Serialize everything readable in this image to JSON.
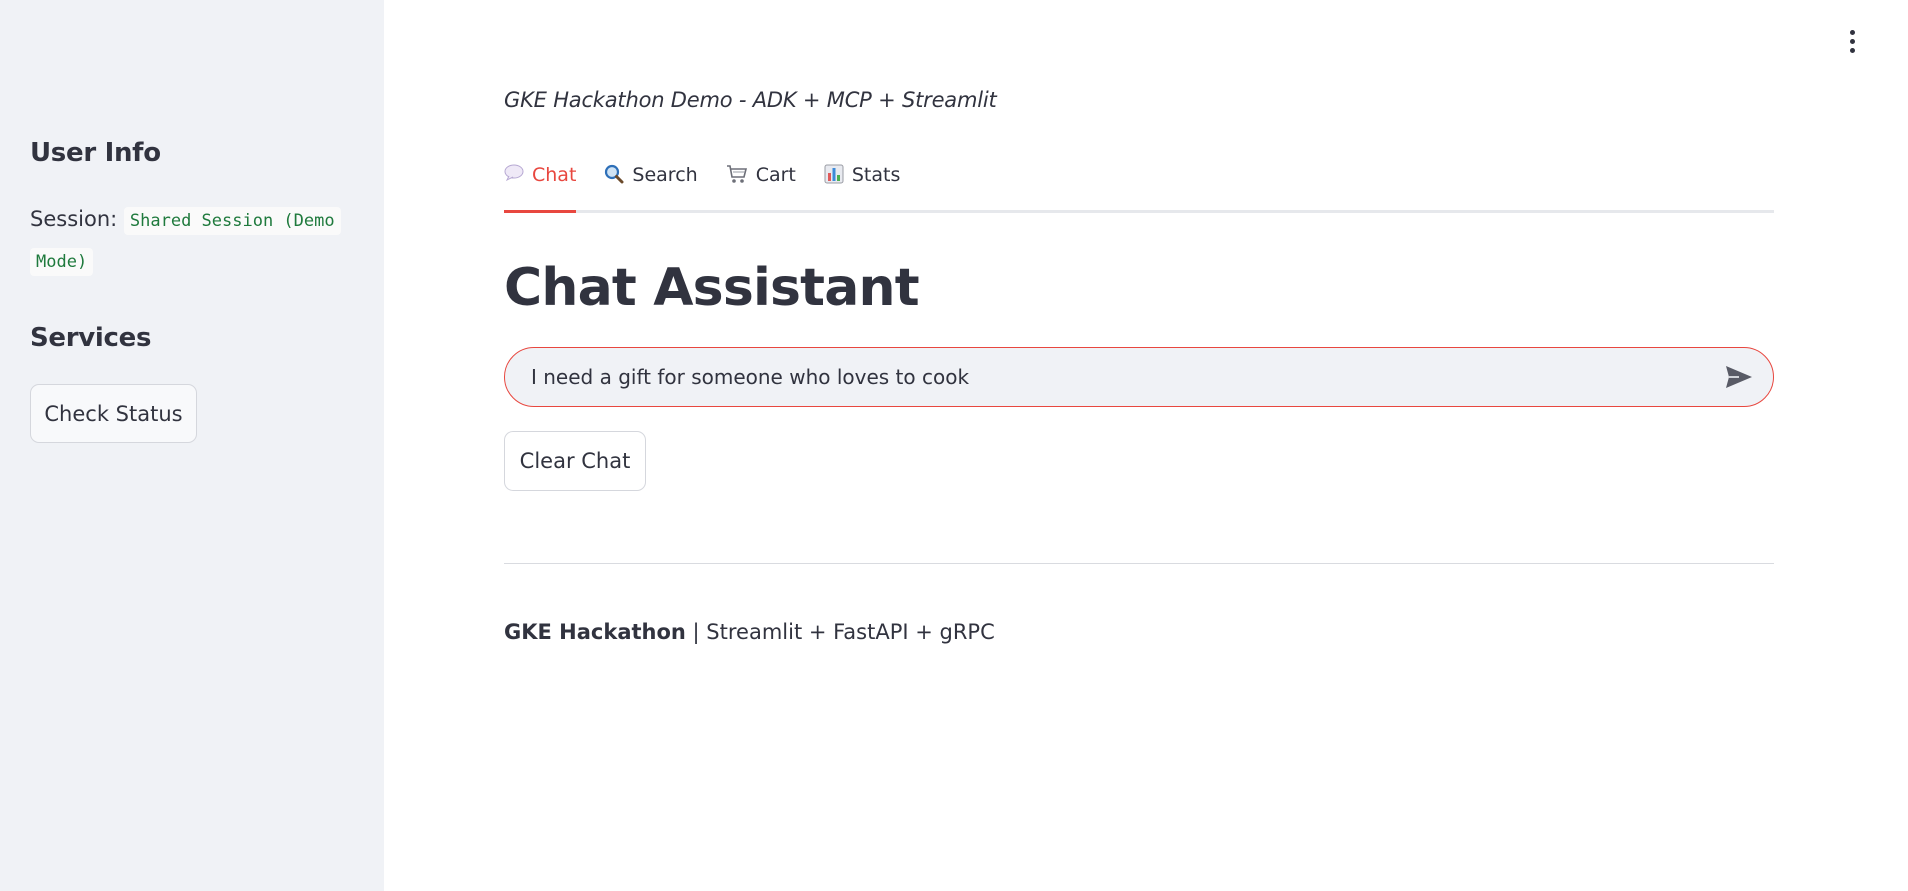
{
  "sidebar": {
    "user_info_heading": "User Info",
    "session_label": "Session:",
    "session_value": "Shared Session (Demo Mode)",
    "services_heading": "Services",
    "check_status_label": "Check Status"
  },
  "header": {
    "caption": "GKE Hackathon Demo - ADK + MCP + Streamlit"
  },
  "tabs": [
    {
      "label": "Chat",
      "icon": "speech-balloon-icon",
      "active": true
    },
    {
      "label": "Search",
      "icon": "magnifier-icon",
      "active": false
    },
    {
      "label": "Cart",
      "icon": "shopping-cart-icon",
      "active": false
    },
    {
      "label": "Stats",
      "icon": "bar-chart-icon",
      "active": false
    }
  ],
  "main": {
    "title": "Chat Assistant",
    "chat_input_value": "I need a gift for someone who loves to cook",
    "clear_chat_label": "Clear Chat"
  },
  "footer": {
    "brand": "GKE Hackathon",
    "rest": " | Streamlit + FastAPI + gRPC"
  },
  "colors": {
    "accent": "#e8473f",
    "sidebar_bg": "#f0f2f6",
    "text": "#31333f",
    "code_text": "#1f7a3d"
  }
}
